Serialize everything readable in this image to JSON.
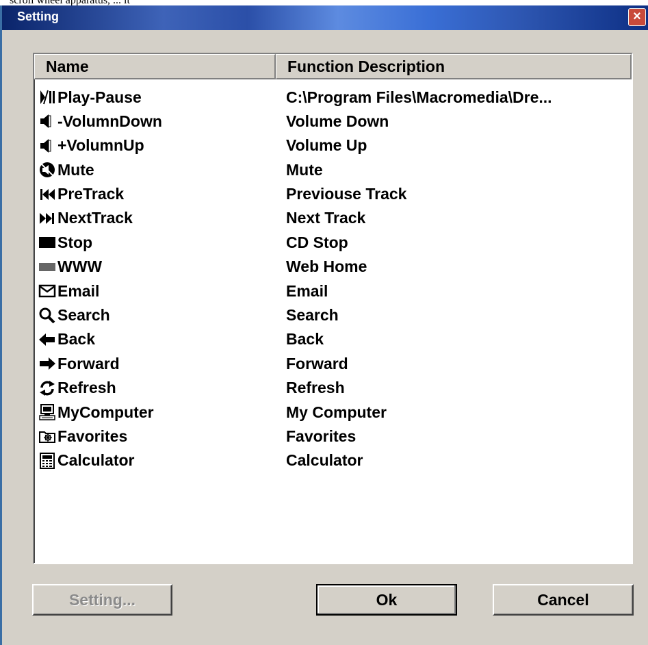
{
  "top_strip_text": "scroll wheel apparatus, ... it",
  "window": {
    "title": "Setting",
    "close_label": "×"
  },
  "list": {
    "columns": [
      "Name",
      "Function Description"
    ],
    "rows": [
      {
        "name": "Play-Pause",
        "icon": "play-pause-icon",
        "description": "C:\\Program Files\\Macromedia\\Dre..."
      },
      {
        "name": "-VolumnDown",
        "icon": "speaker-icon",
        "description": "Volume Down"
      },
      {
        "name": "+VolumnUp",
        "icon": "speaker-icon",
        "description": "Volume Up"
      },
      {
        "name": "Mute",
        "icon": "mute-icon",
        "description": "Mute"
      },
      {
        "name": "PreTrack",
        "icon": "previous-track-icon",
        "description": "Previouse Track"
      },
      {
        "name": "NextTrack",
        "icon": "next-track-icon",
        "description": "Next Track"
      },
      {
        "name": "Stop",
        "icon": "stop-icon",
        "description": "CD Stop"
      },
      {
        "name": "WWW",
        "icon": "www-icon",
        "description": "Web Home"
      },
      {
        "name": "Email",
        "icon": "envelope-icon",
        "description": "Email"
      },
      {
        "name": "Search",
        "icon": "magnifier-icon",
        "description": "Search"
      },
      {
        "name": "Back",
        "icon": "back-arrow-icon",
        "description": "Back"
      },
      {
        "name": "Forward",
        "icon": "forward-arrow-icon",
        "description": "Forward"
      },
      {
        "name": "Refresh",
        "icon": "refresh-icon",
        "description": "Refresh"
      },
      {
        "name": "MyComputer",
        "icon": "computer-icon",
        "description": "My Computer"
      },
      {
        "name": "Favorites",
        "icon": "favorites-folder-icon",
        "description": "Favorites"
      },
      {
        "name": "Calculator",
        "icon": "calculator-icon",
        "description": "Calculator"
      }
    ]
  },
  "buttons": {
    "setting": "Setting...",
    "ok": "Ok",
    "cancel": "Cancel"
  },
  "colors": {
    "dialog_bg": "#d4d0c8",
    "title_dark": "#0a246a",
    "title_light": "#5d8be0",
    "close": "#c84a3a",
    "disabled_text": "#8a8a8a"
  }
}
